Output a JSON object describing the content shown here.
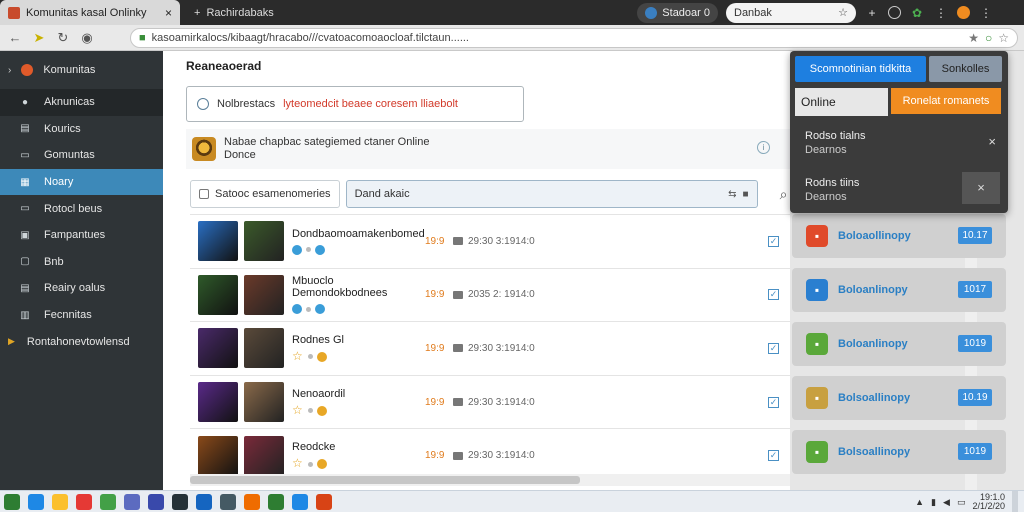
{
  "browser": {
    "tabs": [
      {
        "title": "Komunitas kasal Onlinky",
        "active": true
      },
      {
        "title": "Rachirdabaks",
        "active": false
      }
    ],
    "new_tab": "+",
    "profile_pill": "Stadoar 0",
    "search_pill": "Danbak",
    "url": "kasoamirkalocs/kibaagt/hracabo///cvatoacomoaocloaf.tilctaun......"
  },
  "sidebar": {
    "header": "Komunitas",
    "items": [
      {
        "label": "Aknunicas",
        "icon": "people-icon",
        "state": "dark"
      },
      {
        "label": "Kourics",
        "icon": "list-icon",
        "state": ""
      },
      {
        "label": "Gomuntas",
        "icon": "chat-icon",
        "state": ""
      },
      {
        "label": "Noary",
        "icon": "grid-icon",
        "state": "active"
      },
      {
        "label": "Rotocl beus",
        "icon": "folder-icon",
        "state": ""
      },
      {
        "label": "Fampantues",
        "icon": "users-icon",
        "state": ""
      },
      {
        "label": "Bnb",
        "icon": "box-icon",
        "state": ""
      },
      {
        "label": "Reairy oalus",
        "icon": "doc-icon",
        "state": ""
      },
      {
        "label": "Fecnnitas",
        "icon": "table-icon",
        "state": ""
      },
      {
        "label": "Rontahonevtowlensd",
        "icon": "chevron-right-icon",
        "state": "sub"
      }
    ]
  },
  "main": {
    "heading": "Reaneaoerad",
    "notice": {
      "prefix": "Nolbrestacs",
      "highlight": "lyteomedcit beaee coresem lliaebolt"
    },
    "banner": {
      "line1": "Nabae chapbac sategiemed ctaner Online",
      "line2": "Donce"
    },
    "search": {
      "filter_label": "Satooc esamenomeries",
      "value": "Dand akaic"
    },
    "rows": [
      {
        "title": "Dondbaomoamakenbomed",
        "score": "19:9",
        "meta": "29:30 3:1914:0",
        "badges": [
          "blue",
          "small",
          "blue"
        ],
        "colors": [
          "#2a6fc4",
          "#3b5a2a"
        ]
      },
      {
        "title": "Mbuoclo Demondokbodnees",
        "score": "19:9",
        "meta": "2035 2: 1914:0",
        "badges": [
          "blue",
          "small",
          "blue"
        ],
        "colors": [
          "#2f5a2a",
          "#6b3a2a"
        ]
      },
      {
        "title": "Rodnes Gl",
        "score": "19:9",
        "meta": "29:30 3:1914:0",
        "badges": [
          "star",
          "small",
          "gold"
        ],
        "colors": [
          "#4a2a6a",
          "#5a4a3a"
        ]
      },
      {
        "title": "Nenoaordil",
        "score": "19:9",
        "meta": "29:30 3:1914:0",
        "badges": [
          "star",
          "small",
          "gold"
        ],
        "colors": [
          "#5a2a8a",
          "#8a6a4a"
        ]
      },
      {
        "title": "Reodcke",
        "score": "19:9",
        "meta": "29:30 3:1914:0",
        "badges": [
          "star",
          "small",
          "gold"
        ],
        "colors": [
          "#8a4a1a",
          "#7a2a3a"
        ]
      }
    ]
  },
  "right_panel": {
    "cards": [
      {
        "label": "Boloaollinopy",
        "button": "10.17",
        "icon_color": "#e04a2a"
      },
      {
        "label": "Boloanlinopy",
        "button": "1017",
        "icon_color": "#2a7fd0"
      },
      {
        "label": "Boloanlinopy",
        "button": "1019",
        "icon_color": "#5aa83a"
      },
      {
        "label": "Bolsoallinopy",
        "button": "10.19",
        "icon_color": "#c8a040"
      },
      {
        "label": "Bolsoallinopy",
        "button": "1019",
        "icon_color": "#5aa83a"
      }
    ]
  },
  "popover": {
    "primary_button": "Scomnotinian tidkitta",
    "secondary_button": "Sonkolles",
    "input_value": "Online",
    "action_button": "Ronelat romanets",
    "items": [
      {
        "title": "Rodso tialns",
        "subtitle": "Dearnos"
      },
      {
        "title": "Rodns tiins",
        "subtitle": "Dearnos"
      }
    ]
  },
  "taskbar": {
    "apps": [
      "#2e7d32",
      "#1e88e5",
      "#fbc02d",
      "#e53935",
      "#43a047",
      "#5c6bc0",
      "#3949ab",
      "#263238",
      "#1565c0",
      "#455a64",
      "#ef6c00",
      "#2e7d32",
      "#1e88e5",
      "#d84315"
    ],
    "clock_line1": "19:1.0",
    "clock_line2": "2/1/2/20"
  }
}
